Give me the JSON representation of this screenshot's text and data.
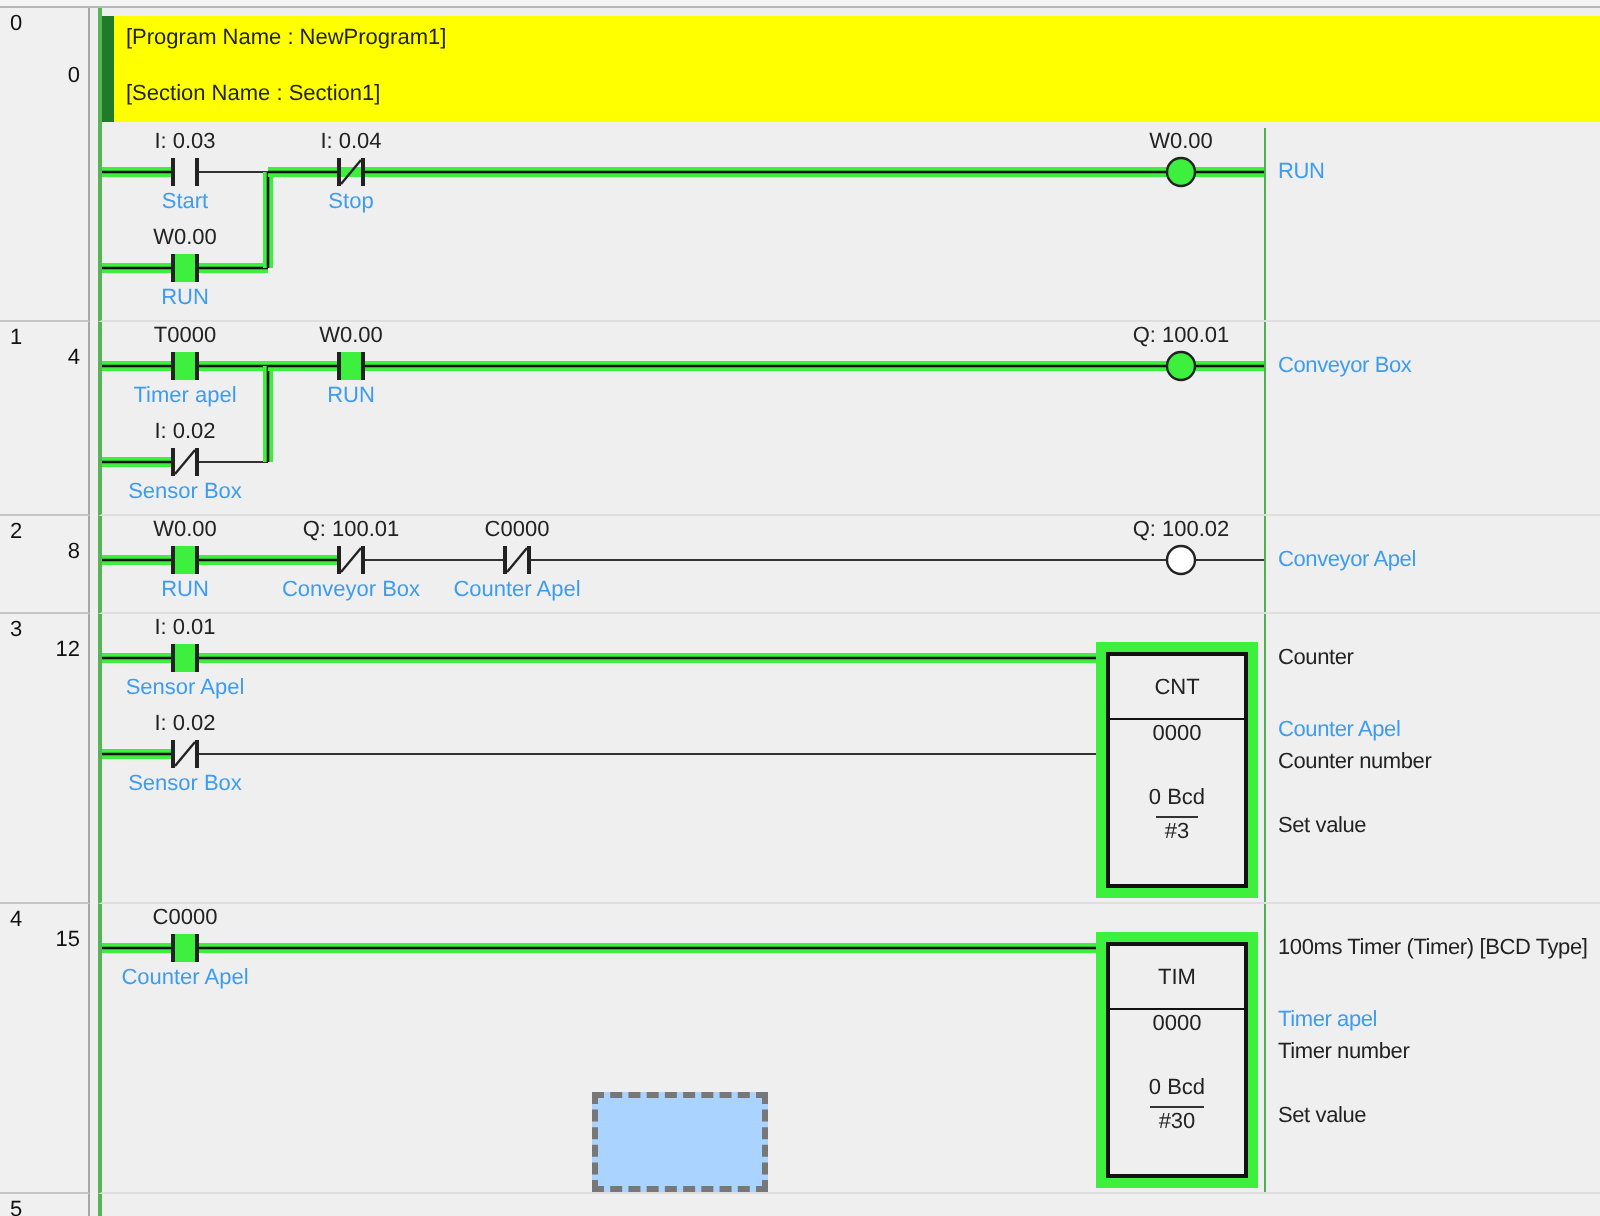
{
  "rungs": [
    {
      "number": "0",
      "step": "0",
      "header": [
        "[Program Name : NewProgram1]",
        "[Section Name : Section1]"
      ],
      "series": [
        {
          "kind": "parallel",
          "branches": [
            [
              {
                "kind": "no",
                "address": "I: 0.03",
                "comment": "Start",
                "on": false
              }
            ],
            [
              {
                "kind": "no",
                "address": "W0.00",
                "comment": "RUN",
                "on": true
              }
            ]
          ]
        },
        {
          "kind": "nc",
          "address": "I: 0.04",
          "comment": "Stop",
          "on": true
        }
      ],
      "output": {
        "kind": "coil",
        "address": "W0.00",
        "comment": "RUN",
        "on": true
      }
    },
    {
      "number": "1",
      "step": "4",
      "series": [
        {
          "kind": "parallel",
          "branches": [
            [
              {
                "kind": "no",
                "address": "T0000",
                "comment": "Timer apel",
                "on": true
              }
            ],
            [
              {
                "kind": "nc",
                "address": "I: 0.02",
                "comment": "Sensor Box",
                "on": false
              }
            ]
          ]
        },
        {
          "kind": "no",
          "address": "W0.00",
          "comment": "RUN",
          "on": true
        }
      ],
      "output": {
        "kind": "coil",
        "address": "Q: 100.01",
        "comment": "Conveyor Box",
        "on": true
      }
    },
    {
      "number": "2",
      "step": "8",
      "series": [
        {
          "kind": "no",
          "address": "W0.00",
          "comment": "RUN",
          "on": true
        },
        {
          "kind": "nc",
          "address": "Q: 100.01",
          "comment": "Conveyor Box",
          "on": false
        },
        {
          "kind": "nc",
          "address": "C0000",
          "comment": "Counter Apel",
          "on": false
        }
      ],
      "output": {
        "kind": "coil",
        "address": "Q: 100.02",
        "comment": "Conveyor Apel",
        "on": false
      }
    },
    {
      "number": "3",
      "step": "12",
      "output": {
        "kind": "box",
        "mnemonic": "CNT",
        "description": "Counter",
        "on": true,
        "inputs": [
          [
            {
              "kind": "no",
              "address": "I: 0.01",
              "comment": "Sensor Apel",
              "on": true
            }
          ],
          [
            {
              "kind": "nc",
              "address": "I: 0.02",
              "comment": "Sensor Box",
              "on": false
            }
          ]
        ],
        "operands": [
          {
            "operand": "0000",
            "comment": "Counter Apel",
            "role": "Counter number"
          },
          {
            "present": "0 Bcd",
            "operand": "#3",
            "role": "Set value"
          }
        ]
      }
    },
    {
      "number": "4",
      "step": "15",
      "drag_selection": true,
      "output": {
        "kind": "box",
        "mnemonic": "TIM",
        "description": "100ms Timer (Timer) [BCD Type]",
        "on": true,
        "inputs": [
          [
            {
              "kind": "no",
              "address": "C0000",
              "comment": "Counter Apel",
              "on": true
            }
          ]
        ],
        "operands": [
          {
            "operand": "0000",
            "comment": "Timer apel",
            "role": "Timer number"
          },
          {
            "present": "0 Bcd",
            "operand": "#30",
            "role": "Set value"
          }
        ]
      }
    },
    {
      "number": "5"
    }
  ]
}
